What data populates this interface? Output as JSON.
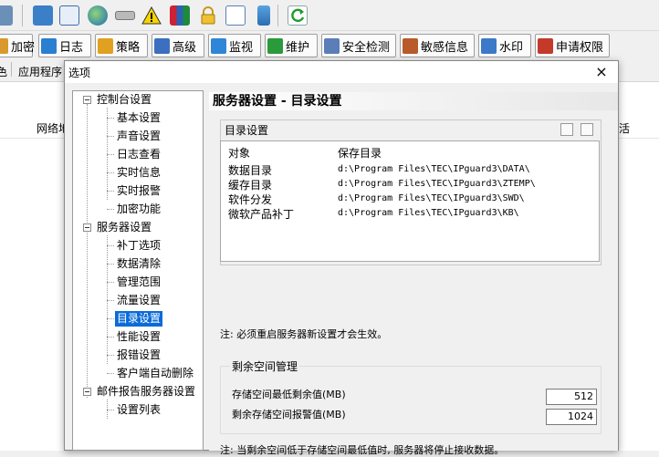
{
  "toolbar": {
    "icons": [
      "report-icon",
      "network-icon",
      "calendar-icon",
      "globe-icon",
      "hardware-icon",
      "warning-icon",
      "books-icon",
      "lock-icon",
      "edit-icon",
      "mobile-icon",
      "refresh-icon"
    ]
  },
  "tabs": [
    {
      "label": "加密",
      "icon": "encrypt-icon",
      "color": "#d89a2c"
    },
    {
      "label": "日志",
      "icon": "log-icon",
      "color": "#2a7fd0"
    },
    {
      "label": "策略",
      "icon": "policy-icon",
      "color": "#e0a020"
    },
    {
      "label": "高级",
      "icon": "advanced-icon",
      "color": "#3d6fbf"
    },
    {
      "label": "监视",
      "icon": "monitor-icon",
      "color": "#2f86d6"
    },
    {
      "label": "维护",
      "icon": "maintain-icon",
      "color": "#2a9a3a"
    },
    {
      "label": "安全检测",
      "icon": "security-check-icon",
      "color": "#5b7db8"
    },
    {
      "label": "敏感信息",
      "icon": "sensitive-info-icon",
      "color": "#b85a2a"
    },
    {
      "label": "水印",
      "icon": "watermark-icon",
      "color": "#3c79c8"
    },
    {
      "label": "申请权限",
      "icon": "request-permission-icon",
      "color": "#c33a2a"
    }
  ],
  "row3": {
    "left_text": "色",
    "app_label": "应用程序",
    "options_label": "选项"
  },
  "background": {
    "col_left": "网络地",
    "col_right": "活"
  },
  "dialog": {
    "title": "选项",
    "close": "×",
    "tree": {
      "groups": [
        {
          "label": "控制台设置",
          "children": [
            "基本设置",
            "声音设置",
            "日志查看",
            "实时信息",
            "实时报警",
            "加密功能"
          ]
        },
        {
          "label": "服务器设置",
          "children": [
            "补丁选项",
            "数据清除",
            "管理范围",
            "流量设置",
            "目录设置",
            "性能设置",
            "报错设置",
            "客户端自动删除"
          ]
        },
        {
          "label": "邮件报告服务器设置",
          "children": [
            "设置列表"
          ]
        }
      ],
      "selected": "目录设置"
    },
    "panel": {
      "title": "服务器设置 - 目录设置",
      "dir_box_title": "目录设置",
      "col_object": "对象",
      "col_dir": "保存目录",
      "rows": [
        {
          "object": "数据目录",
          "dir": "d:\\Program Files\\TEC\\IPguard3\\DATA\\"
        },
        {
          "object": "缓存目录",
          "dir": "d:\\Program Files\\TEC\\IPguard3\\ZTEMP\\"
        },
        {
          "object": "软件分发",
          "dir": "d:\\Program Files\\TEC\\IPguard3\\SWD\\"
        },
        {
          "object": "微软产品补丁",
          "dir": "d:\\Program Files\\TEC\\IPguard3\\KB\\"
        }
      ],
      "note1": "注: 必须重启服务器新设置才会生效。",
      "space_group_title": "剩余空间管理",
      "min_space_label": "存储空间最低剩余值(MB)",
      "min_space_value": "512",
      "alarm_label": "剩余存储空间报警值(MB)",
      "alarm_value": "1024",
      "note2": "注: 当剩余空间低于存储空间最低值时, 服务器将停止接收数据。"
    }
  }
}
